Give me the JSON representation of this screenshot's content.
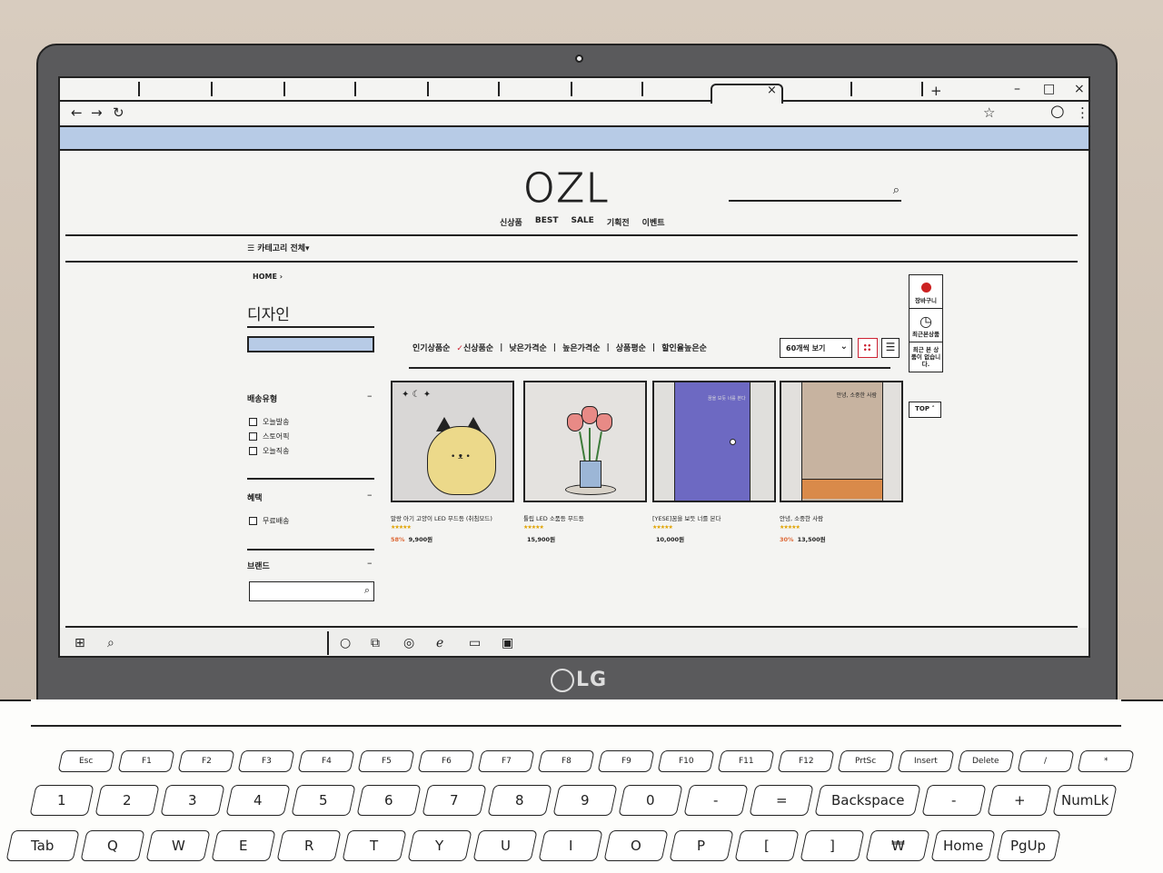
{
  "device": {
    "brand": "LG"
  },
  "browser": {
    "tab_close": "×",
    "new_tab": "+",
    "window": {
      "minimize": "–",
      "maximize": "□",
      "close": "×"
    },
    "nav": {
      "back": "←",
      "forward": "→",
      "reload": "↻",
      "bookmark": "☆",
      "profile": "○",
      "menu": "⋮"
    }
  },
  "site": {
    "logo": "OZL",
    "top_menu": [
      "신상품",
      "BEST",
      "SALE",
      "기획전",
      "이벤트"
    ],
    "category_all": "카테고리 전체",
    "breadcrumb": "HOME",
    "page_title": "디자인",
    "filters": [
      {
        "title": "배송유형",
        "options": [
          "오늘발송",
          "스토어픽",
          "오늘직송"
        ]
      },
      {
        "title": "혜택",
        "options": [
          "무료배송"
        ]
      },
      {
        "title": "브랜드",
        "options": []
      }
    ],
    "sort": {
      "options": [
        "인기상품순",
        "신상품순",
        "낮은가격순",
        "높은가격순",
        "상품평순",
        "할인율높은순"
      ],
      "selected": "신상품순"
    },
    "per_page": "60개씩 보기",
    "products": [
      {
        "name": "말랑 아기 고양이 LED 무드등 (취침모드)",
        "stars": "★★★★★",
        "discount": "58%",
        "price": "9,900원"
      },
      {
        "name": "튤립 LED 소품등 무드등",
        "stars": "★★★★★",
        "discount": "",
        "price": "15,900원"
      },
      {
        "name": "[YESE]꿈을 보듯 너를 본다",
        "stars": "★★★★★",
        "discount": "",
        "price": "10,000원"
      },
      {
        "name": "안녕, 소중한 사람",
        "stars": "★★★★★",
        "discount": "30%",
        "price": "13,500원"
      }
    ],
    "quick_menu": {
      "cart": "장바구니",
      "recent": "최근본상품",
      "empty": "최근 본 상품이 없습니다.",
      "top": "TOP"
    },
    "thumb_texts": {
      "door": "꿈을 보듯 너를 본다",
      "poster": "안녕, 소중한 사람"
    }
  },
  "keyboard": {
    "row1": [
      "Esc",
      "F1",
      "F2",
      "F3",
      "F4",
      "F5",
      "F6",
      "F7",
      "F8",
      "F9",
      "F10",
      "F11",
      "F12",
      "PrtSc",
      "Insert",
      "Delete",
      "/",
      "*"
    ],
    "row2": [
      "1",
      "2",
      "3",
      "4",
      "5",
      "6",
      "7",
      "8",
      "9",
      "0",
      "-",
      "=",
      "Backspace",
      "-",
      "+",
      "NumLk"
    ],
    "row3": [
      "Tab",
      "Q",
      "W",
      "E",
      "R",
      "T",
      "Y",
      "U",
      "I",
      "O",
      "P",
      "[",
      "]",
      "₩",
      "Home",
      "PgUp"
    ]
  }
}
